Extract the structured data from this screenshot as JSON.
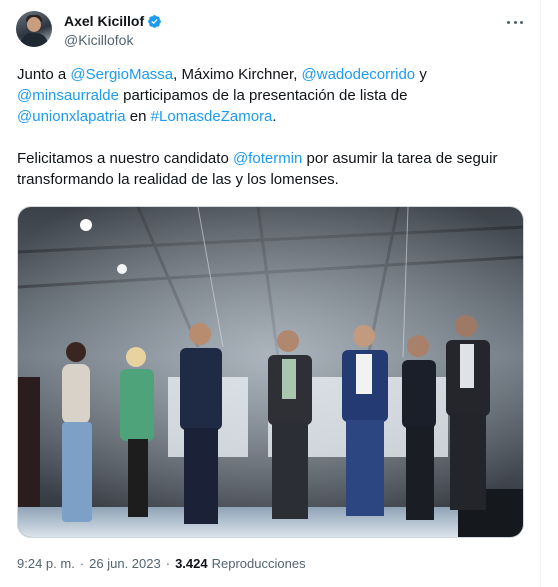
{
  "author": {
    "display_name": "Axel Kicillof",
    "handle": "@Kicillofok",
    "verified": true,
    "avatar_icon": "profile-photo",
    "verified_icon": "verified-badge-icon"
  },
  "tweet": {
    "p1": {
      "s1": "Junto a ",
      "m1": "@SergioMassa",
      "s2": ", Máximo Kirchner, ",
      "m2": "@wadodecorrido",
      "s3": " y",
      "m3": "@minsaurralde",
      "s4": " participamos de la presentación de lista de",
      "m4": "@unionxlapatria",
      "s5": " en ",
      "m5": "#LomasdeZamora",
      "s6": "."
    },
    "p2": {
      "s1": "Felicitamos a nuestro candidato ",
      "m1": "@fotermin",
      "s2": " por asumir la tarea de seguir",
      "s3": "transformando la realidad de las y los lomenses."
    }
  },
  "meta": {
    "time": "9:24 p. m.",
    "separator": "·",
    "date": "26 jun. 2023",
    "views": "3.424",
    "views_label": "Reproducciones"
  },
  "colors": {
    "link": "#1d9bf0",
    "text": "#0f1419",
    "secondary": "#536471"
  }
}
